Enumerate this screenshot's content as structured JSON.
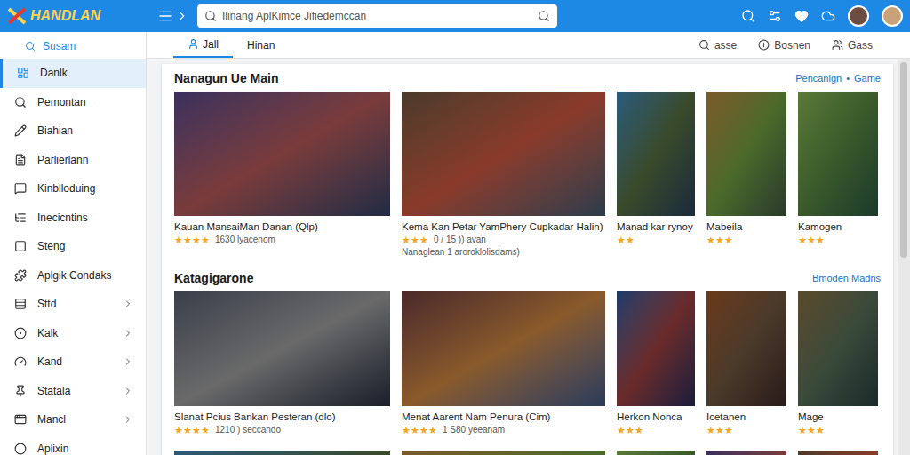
{
  "window": {
    "title": "HANDLAN"
  },
  "topbar": {
    "search": {
      "placeholder": "Ilinang AplKimce Jifiedemccan"
    }
  },
  "sidebar": {
    "search_label": "Susam",
    "items": [
      {
        "label": "Danlk",
        "selected": true,
        "has_submenu": false
      },
      {
        "label": "Pemontan",
        "selected": false,
        "has_submenu": false
      },
      {
        "label": "Biahian",
        "selected": false,
        "has_submenu": false
      },
      {
        "label": "Parlierlann",
        "selected": false,
        "has_submenu": false
      },
      {
        "label": "Kinblloduing",
        "selected": false,
        "has_submenu": false
      },
      {
        "label": "Inecicntins",
        "selected": false,
        "has_submenu": false
      },
      {
        "label": "Steng",
        "selected": false,
        "has_submenu": false
      },
      {
        "label": "Aplgik Condaks",
        "selected": false,
        "has_submenu": false
      },
      {
        "label": "Sttd",
        "selected": false,
        "has_submenu": true
      },
      {
        "label": "Kalk",
        "selected": false,
        "has_submenu": true
      },
      {
        "label": "Kand",
        "selected": false,
        "has_submenu": true
      },
      {
        "label": "Statala",
        "selected": false,
        "has_submenu": true
      },
      {
        "label": "Mancl",
        "selected": false,
        "has_submenu": true
      },
      {
        "label": "Aplixin",
        "selected": false,
        "has_submenu": false
      }
    ]
  },
  "tabs": [
    {
      "label": "Jall",
      "selected": true
    },
    {
      "label": "Hinan",
      "selected": false
    }
  ],
  "actions": [
    "asse",
    "Bosnen",
    "Gass"
  ],
  "star": "★",
  "sections": [
    {
      "title": "Nanagun Ue Main",
      "links": [
        "Pencanign",
        "•",
        "Game"
      ],
      "cards": [
        {
          "title": "Kauan MansaiMan Danan (Qlp)",
          "stars": 4,
          "meta": "1630 lyacenom",
          "sub": ""
        },
        {
          "title": "Kema Kan Petar YamPhery Cupkadar Halin)",
          "stars": 3,
          "meta": "0 / 15 )) avan",
          "sub": "Nanaglean 1 aroroklolisdams)"
        },
        {
          "title": "Manad kar rynoy",
          "stars": 2,
          "meta": "",
          "sub": ""
        },
        {
          "title": "Mabeila",
          "stars": 3,
          "meta": "",
          "sub": ""
        },
        {
          "title": "Kamogen",
          "stars": 3,
          "meta": "",
          "sub": ""
        }
      ]
    },
    {
      "title": "Katagigarone",
      "links": [
        "Bmoden Madns"
      ],
      "cards": [
        {
          "title": "Slanat Pcius Bankan Pesteran (dlo)",
          "stars": 4,
          "meta": "1210 ) seccando",
          "sub": ""
        },
        {
          "title": "Menat Aarent Nam Penura (Cim)",
          "stars": 4,
          "meta": "1 S80 yeeanam",
          "sub": ""
        },
        {
          "title": "Herkon Nonca",
          "stars": 3,
          "meta": "",
          "sub": ""
        },
        {
          "title": "Icetanen",
          "stars": 3,
          "meta": "",
          "sub": ""
        },
        {
          "title": "Mage",
          "stars": 3,
          "meta": "",
          "sub": ""
        }
      ]
    }
  ]
}
